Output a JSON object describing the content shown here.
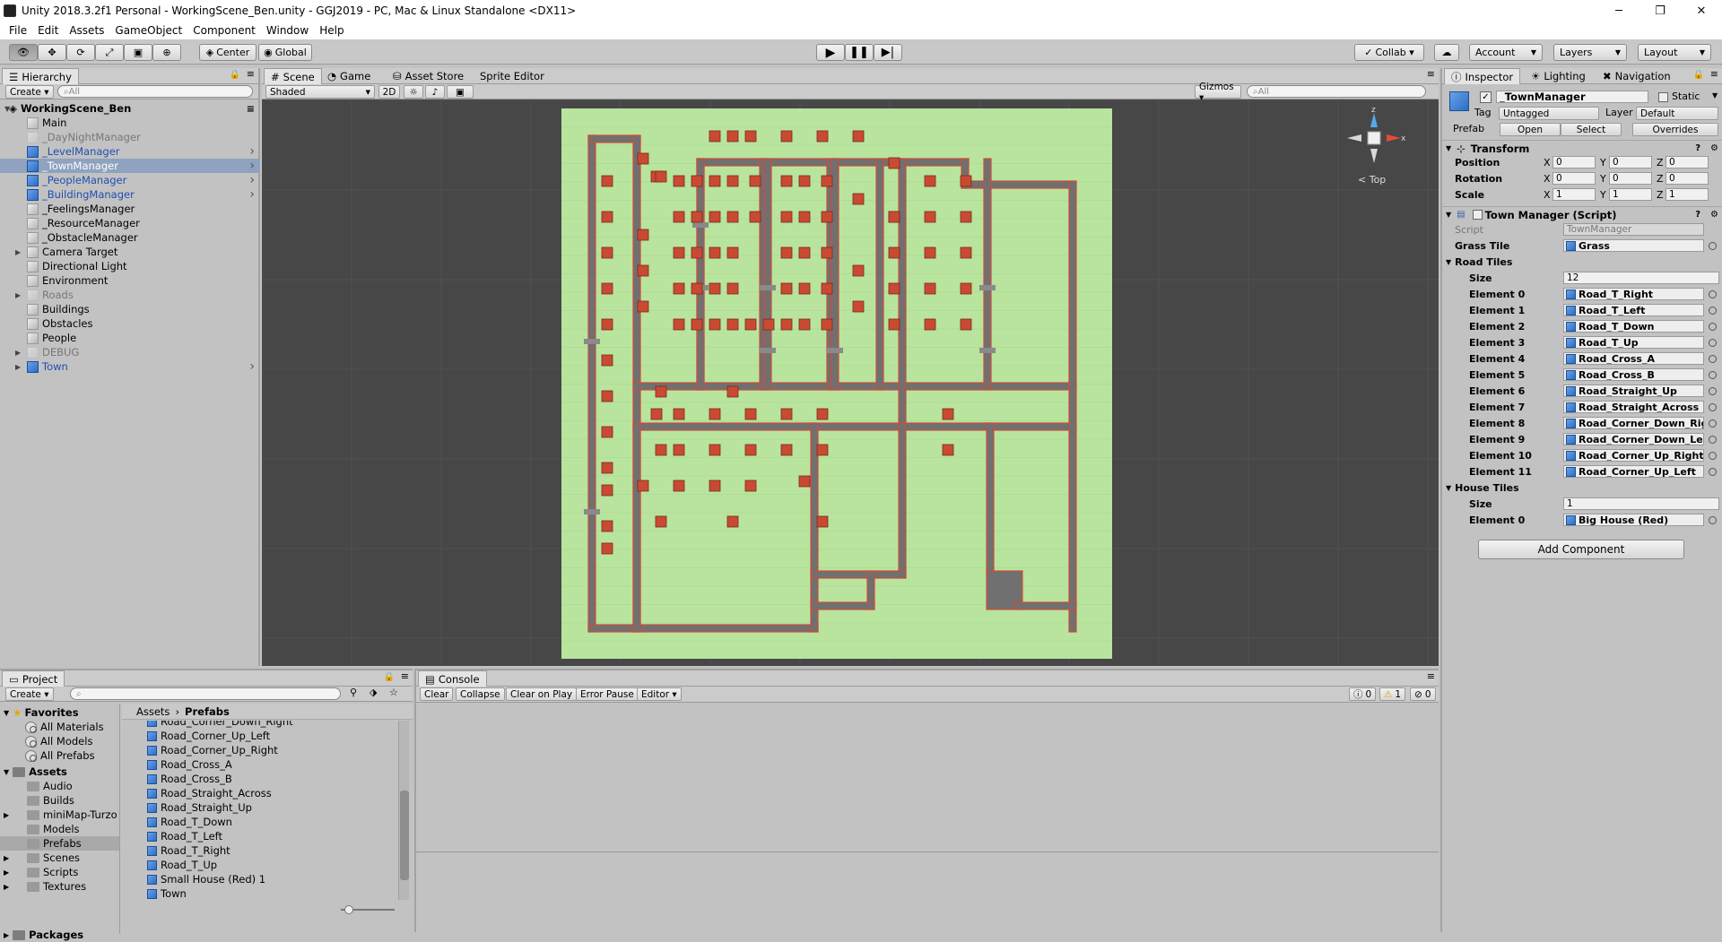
{
  "window": {
    "title": "Unity 2018.3.2f1 Personal - WorkingScene_Ben.unity - GGJ2019 - PC, Mac & Linux Standalone <DX11>",
    "minimize": "─",
    "restore": "❐",
    "close": "✕"
  },
  "menu": [
    "File",
    "Edit",
    "Assets",
    "GameObject",
    "Component",
    "Window",
    "Help"
  ],
  "toolbar": {
    "center_label": "Center",
    "global_label": "Global",
    "collab_label": "Collab ▾",
    "account_label": "Account",
    "layers_label": "Layers",
    "layout_label": "Layout"
  },
  "hierarchy": {
    "tab_label": "Hierarchy",
    "create_label": "Create ▾",
    "search_placeholder": "All",
    "scene_name": "WorkingScene_Ben",
    "items": [
      {
        "label": "Main",
        "icon": "grey",
        "arrow": false
      },
      {
        "label": "_DayNightManager",
        "icon": "faint",
        "arrow": false,
        "dim": true
      },
      {
        "label": "_LevelManager",
        "icon": "blue",
        "arrow": true,
        "blue": true
      },
      {
        "label": "_TownManager",
        "icon": "blue",
        "arrow": true,
        "blue": true,
        "selected": true
      },
      {
        "label": "_PeopleManager",
        "icon": "blue",
        "arrow": true,
        "blue": true
      },
      {
        "label": "_BuildingManager",
        "icon": "blue",
        "arrow": true,
        "blue": true
      },
      {
        "label": "_FeelingsManager",
        "icon": "grey",
        "arrow": false
      },
      {
        "label": "_ResourceManager",
        "icon": "grey",
        "arrow": false
      },
      {
        "label": "_ObstacleManager",
        "icon": "grey",
        "arrow": false
      },
      {
        "label": "Camera Target",
        "icon": "grey",
        "arrow": false,
        "fold": true
      },
      {
        "label": "Directional Light",
        "icon": "grey",
        "arrow": false
      },
      {
        "label": "Environment",
        "icon": "grey",
        "arrow": false
      },
      {
        "label": "Roads",
        "icon": "faint",
        "arrow": false,
        "fold": true,
        "dim": true
      },
      {
        "label": "Buildings",
        "icon": "grey",
        "arrow": false
      },
      {
        "label": "Obstacles",
        "icon": "grey",
        "arrow": false
      },
      {
        "label": "People",
        "icon": "grey",
        "arrow": false
      },
      {
        "label": "DEBUG",
        "icon": "faint",
        "arrow": false,
        "fold": true,
        "dim": true
      },
      {
        "label": "Town",
        "icon": "blue",
        "arrow": true,
        "blue": true,
        "fold": true
      }
    ]
  },
  "scene": {
    "tabs": [
      "Scene",
      "Game",
      "Asset Store",
      "Sprite Editor"
    ],
    "shading": "Shaded",
    "mode_2d": "2D",
    "gizmos": "Gizmos ▾",
    "search_placeholder": "All",
    "view_label": "< Top",
    "colors": {
      "grass": "#b8e49e",
      "road": "#707070",
      "road_edge": "#d24a3a",
      "house": "#c94a32"
    }
  },
  "inspector": {
    "tabs": [
      "Inspector",
      "Lighting",
      "Navigation"
    ],
    "object_name": "_TownManager",
    "static_label": "Static",
    "tag_label": "Tag",
    "tag_value": "Untagged",
    "layer_label": "Layer",
    "layer_value": "Default",
    "prefab_label": "Prefab",
    "open_label": "Open",
    "select_label": "Select",
    "overrides_label": "Overrides",
    "transform": {
      "header": "Transform",
      "position_label": "Position",
      "rotation_label": "Rotation",
      "scale_label": "Scale",
      "position": [
        "0",
        "0",
        "0"
      ],
      "rotation": [
        "0",
        "0",
        "0"
      ],
      "scale": [
        "1",
        "1",
        "1"
      ]
    },
    "script": {
      "header": "Town Manager (Script)",
      "script_label": "Script",
      "script_value": "TownManager",
      "grass_label": "Grass Tile",
      "grass_value": "Grass",
      "road_tiles_label": "Road Tiles",
      "size_label": "Size",
      "road_size": "12",
      "road_elements": [
        {
          "label": "Element 0",
          "value": "Road_T_Right"
        },
        {
          "label": "Element 1",
          "value": "Road_T_Left"
        },
        {
          "label": "Element 2",
          "value": "Road_T_Down"
        },
        {
          "label": "Element 3",
          "value": "Road_T_Up"
        },
        {
          "label": "Element 4",
          "value": "Road_Cross_A"
        },
        {
          "label": "Element 5",
          "value": "Road_Cross_B"
        },
        {
          "label": "Element 6",
          "value": "Road_Straight_Up"
        },
        {
          "label": "Element 7",
          "value": "Road_Straight_Across"
        },
        {
          "label": "Element 8",
          "value": "Road_Corner_Down_Right"
        },
        {
          "label": "Element 9",
          "value": "Road_Corner_Down_Left"
        },
        {
          "label": "Element 10",
          "value": "Road_Corner_Up_Right"
        },
        {
          "label": "Element 11",
          "value": "Road_Corner_Up_Left"
        }
      ],
      "house_tiles_label": "House Tiles",
      "house_size": "1",
      "house_elements": [
        {
          "label": "Element 0",
          "value": "Big House (Red)"
        }
      ]
    },
    "add_component": "Add Component"
  },
  "project": {
    "tab_label": "Project",
    "create_label": "Create ▾",
    "breadcrumb": [
      "Assets",
      "Prefabs"
    ],
    "favorites_label": "Favorites",
    "favorites": [
      "All Materials",
      "All Models",
      "All Prefabs"
    ],
    "assets_label": "Assets",
    "folders": [
      {
        "label": "Audio",
        "fold": false
      },
      {
        "label": "Builds",
        "fold": false
      },
      {
        "label": "miniMap-Turzo",
        "fold": true
      },
      {
        "label": "Models",
        "fold": false
      },
      {
        "label": "Prefabs",
        "fold": false,
        "selected": true
      },
      {
        "label": "Scenes",
        "fold": true
      },
      {
        "label": "Scripts",
        "fold": true
      },
      {
        "label": "Textures",
        "fold": true
      }
    ],
    "packages_label": "Packages",
    "files": [
      "Road_Corner_Down_Right",
      "Road_Corner_Up_Left",
      "Road_Corner_Up_Right",
      "Road_Cross_A",
      "Road_Cross_B",
      "Road_Straight_Across",
      "Road_Straight_Up",
      "Road_T_Down",
      "Road_T_Left",
      "Road_T_Right",
      "Road_T_Up",
      "Small House (Red) 1",
      "Town"
    ]
  },
  "console": {
    "tab_label": "Console",
    "buttons": [
      "Clear",
      "Collapse",
      "Clear on Play",
      "Error Pause",
      "Editor ▾"
    ],
    "info_count": "0",
    "warning_count": "1",
    "error_count": "0"
  }
}
